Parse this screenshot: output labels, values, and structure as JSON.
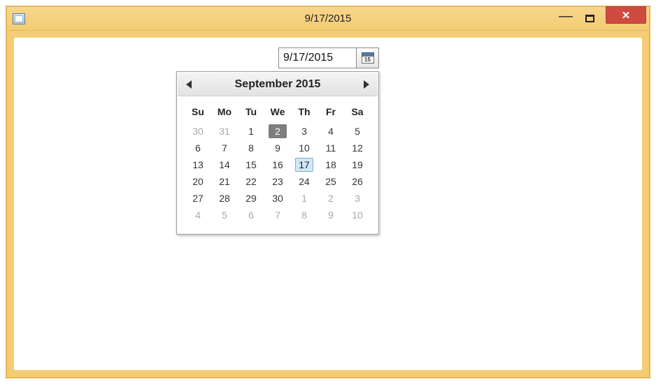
{
  "window": {
    "title": "9/17/2015"
  },
  "date_input": {
    "value": "9/17/2015",
    "button_icon_text": "15"
  },
  "calendar": {
    "header": "September 2015",
    "dow": [
      "Su",
      "Mo",
      "Tu",
      "We",
      "Th",
      "Fr",
      "Sa"
    ],
    "today_day": 2,
    "selected_day": 17,
    "weeks": [
      [
        {
          "n": 30,
          "other": true
        },
        {
          "n": 31,
          "other": true
        },
        {
          "n": 1
        },
        {
          "n": 2
        },
        {
          "n": 3
        },
        {
          "n": 4
        },
        {
          "n": 5
        }
      ],
      [
        {
          "n": 6
        },
        {
          "n": 7
        },
        {
          "n": 8
        },
        {
          "n": 9
        },
        {
          "n": 10
        },
        {
          "n": 11
        },
        {
          "n": 12
        }
      ],
      [
        {
          "n": 13
        },
        {
          "n": 14
        },
        {
          "n": 15
        },
        {
          "n": 16
        },
        {
          "n": 17
        },
        {
          "n": 18
        },
        {
          "n": 19
        }
      ],
      [
        {
          "n": 20
        },
        {
          "n": 21
        },
        {
          "n": 22
        },
        {
          "n": 23
        },
        {
          "n": 24
        },
        {
          "n": 25
        },
        {
          "n": 26
        }
      ],
      [
        {
          "n": 27
        },
        {
          "n": 28
        },
        {
          "n": 29
        },
        {
          "n": 30
        },
        {
          "n": 1,
          "other": true
        },
        {
          "n": 2,
          "other": true
        },
        {
          "n": 3,
          "other": true
        }
      ],
      [
        {
          "n": 4,
          "other": true
        },
        {
          "n": 5,
          "other": true
        },
        {
          "n": 6,
          "other": true
        },
        {
          "n": 7,
          "other": true
        },
        {
          "n": 8,
          "other": true
        },
        {
          "n": 9,
          "other": true
        },
        {
          "n": 10,
          "other": true
        }
      ]
    ]
  },
  "colors": {
    "accent_border": "#e8b558",
    "titlebar_bg": "#f3cc74",
    "close_bg": "#cf4b41",
    "today_bg": "#7d7d7d",
    "selected_bg": "#cfe8f6",
    "selected_border": "#2e6ea0"
  }
}
